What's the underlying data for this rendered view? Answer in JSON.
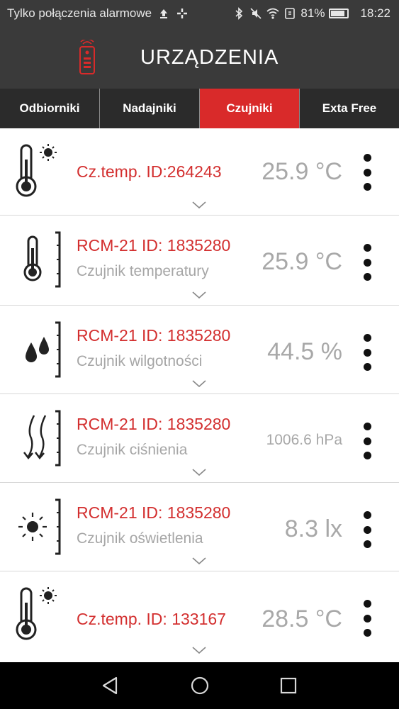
{
  "status_bar": {
    "carrier_text": "Tylko połączenia alarmowe",
    "battery": "81%",
    "time": "18:22"
  },
  "app_bar": {
    "title": "URZĄDZENIA"
  },
  "tabs": [
    {
      "label": "Odbiorniki",
      "active": false
    },
    {
      "label": "Nadajniki",
      "active": false
    },
    {
      "label": "Czujniki",
      "active": true
    },
    {
      "label": "Exta Free",
      "active": false
    }
  ],
  "sensors": [
    {
      "name": "Cz.temp. ID:264243",
      "type": "",
      "value": "25.9 °C",
      "icon": "thermometer-sun-icon"
    },
    {
      "name": "RCM-21 ID: 1835280",
      "type": "Czujnik temperatury",
      "value": "25.9 °C",
      "icon": "thermometer-icon"
    },
    {
      "name": "RCM-21 ID: 1835280",
      "type": "Czujnik wilgotności",
      "value": "44.5 %",
      "icon": "humidity-drops-icon"
    },
    {
      "name": "RCM-21 ID: 1835280",
      "type": "Czujnik ciśnienia",
      "value": "1006.6 hPa",
      "icon": "pressure-arrows-icon"
    },
    {
      "name": "RCM-21 ID: 1835280",
      "type": "Czujnik oświetlenia",
      "value": "8.3 lx",
      "icon": "sun-icon"
    },
    {
      "name": "Cz.temp. ID: 133167",
      "type": "",
      "value": "28.5 °C",
      "icon": "thermometer-sun-icon"
    }
  ],
  "colors": {
    "accent": "#d92a2a",
    "header_bg": "#3a3a3a",
    "value_gray": "#a8a8a8"
  }
}
